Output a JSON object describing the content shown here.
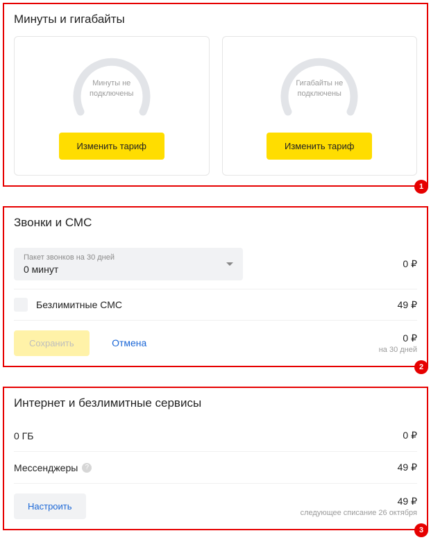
{
  "section1": {
    "title": "Минуты и гигабайты",
    "marker": "1",
    "cards": [
      {
        "gauge_line1": "Минуты не",
        "gauge_line2": "подключены",
        "button": "Изменить тариф"
      },
      {
        "gauge_line1": "Гигабайты не",
        "gauge_line2": "подключены",
        "button": "Изменить тариф"
      }
    ]
  },
  "section2": {
    "title": "Звонки и СМС",
    "marker": "2",
    "select": {
      "label": "Пакет звонков на 30 дней",
      "value": "0 минут",
      "price": "0 ₽"
    },
    "sms": {
      "label": "Безлимитные СМС",
      "price": "49 ₽"
    },
    "save": "Сохранить",
    "cancel": "Отмена",
    "total": "0 ₽",
    "period": "на 30 дней"
  },
  "section3": {
    "title": "Интернет и безлимитные сервисы",
    "marker": "3",
    "data": {
      "label": "0 ГБ",
      "price": "0 ₽"
    },
    "mess": {
      "label": "Мессенджеры",
      "price": "49 ₽"
    },
    "configure": "Настроить",
    "total": "49 ₽",
    "next": "следующее списание 26 октября"
  }
}
